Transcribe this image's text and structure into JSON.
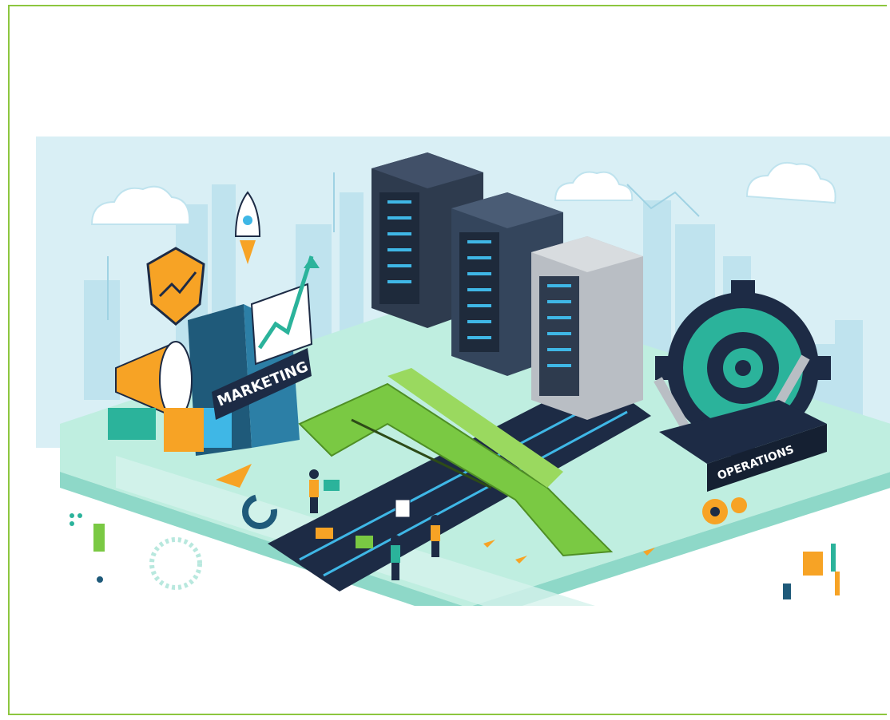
{
  "illustration": {
    "marketing_label": "MARKETING",
    "operations_label": "OPERATIONS"
  },
  "colors": {
    "frame_border": "#8dc63f",
    "sky": "#d9eff5",
    "platform": "#bfeee0",
    "platform_edge": "#8ed8c8",
    "bridge_green": "#7ac943",
    "road_dark": "#1d2b45",
    "server_dark": "#2e3b4e",
    "server_gray": "#b9bec4",
    "gear_teal": "#2bb39b",
    "accent_orange": "#f7a325",
    "accent_blue": "#2da8d8"
  },
  "icons": [
    "cloud-icon",
    "rocket-icon",
    "shield-icon",
    "megaphone-icon",
    "trend-chart-icon",
    "server-icon",
    "gear-icon",
    "wrench-icon",
    "pie-chart-icon",
    "person-icon"
  ]
}
